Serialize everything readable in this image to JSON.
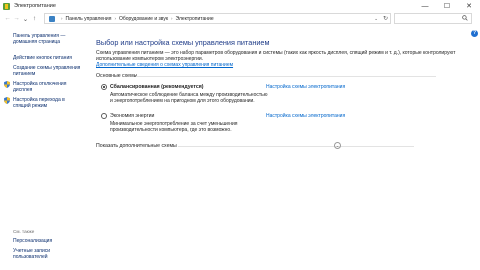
{
  "window": {
    "title": "Электропитание",
    "minimize_glyph": "—",
    "maximize_glyph": "☐",
    "close_glyph": "✕"
  },
  "address": {
    "crumbs": [
      "Панель управления",
      "Оборудование и звук",
      "Электропитание"
    ],
    "separator": "›",
    "dropdown_glyph": "⌄",
    "refresh_glyph": "↻",
    "search_icon": "magnifier-icon"
  },
  "nav": {
    "back_glyph": "←",
    "forward_glyph": "→",
    "recent_glyph": "⌄",
    "up_glyph": "↑"
  },
  "sidebar": {
    "home": "Панель управления — домашняя страница",
    "items": [
      {
        "label": "Действие кнопок питания",
        "icon": "none"
      },
      {
        "label": "Создание схемы управления питанием",
        "icon": "none"
      },
      {
        "label": "Настройка отключения дисплея",
        "icon": "shield-icon"
      },
      {
        "label": "Настройка перехода в спящий режим",
        "icon": "shield-icon"
      }
    ],
    "see_also_label": "См. также",
    "see_also": [
      "Персонализация",
      "Учетные записи пользователей"
    ]
  },
  "main": {
    "heading": "Выбор или настройка схемы управления питанием",
    "description": "Схема управления питанием — это набор параметров оборудования и системы (таких как яркость дисплея, спящий режим и т. д.), которые контролируют использование компьютером электроэнергии.",
    "more_info_link": "Дополнительные сведения о схемах управления питанием",
    "section_label": "Основные схемы",
    "plans": [
      {
        "name": "Сбалансированная (рекомендуется)",
        "selected": true,
        "settings_link": "Настройка схемы электропитания",
        "description": "Автоматическое соблюдение баланса между производительностью и энергопотреблением на пригодном для этого оборудовании."
      },
      {
        "name": "Экономия энергии",
        "selected": false,
        "settings_link": "Настройка схемы электропитания",
        "description": "Минимальное энергопотребление за счет уменьшения производительности компьютера, где это возможно."
      }
    ],
    "show_more_label": "Показать дополнительные схемы",
    "show_more_glyph": "⌄"
  },
  "help_glyph": "?"
}
